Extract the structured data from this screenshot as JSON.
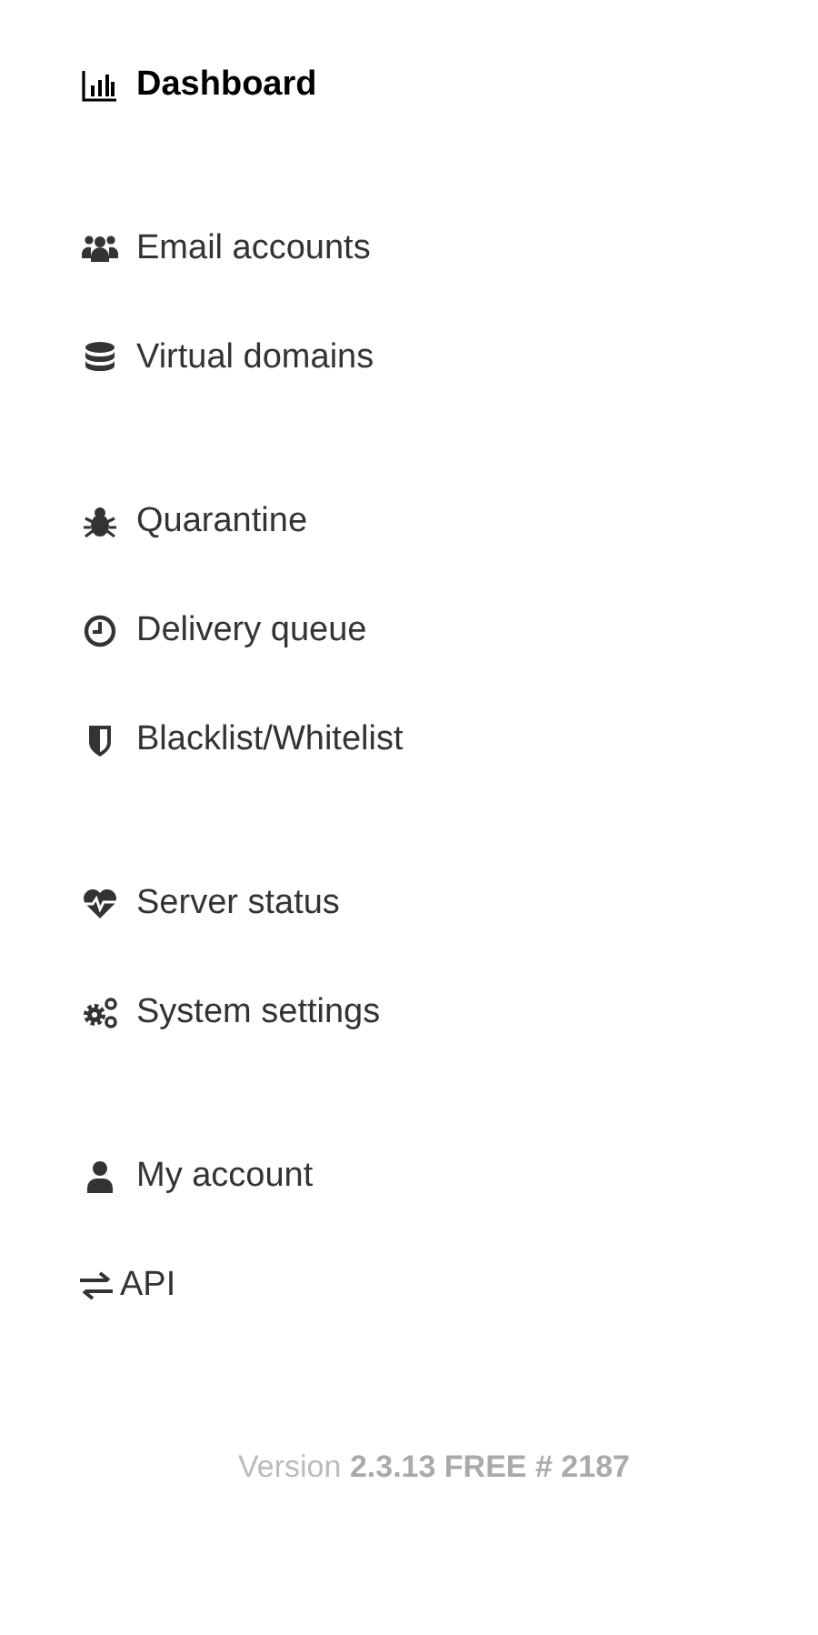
{
  "nav_groups": [
    {
      "items": [
        {
          "label": "Dashboard",
          "selected": true
        }
      ]
    },
    {
      "items": [
        {
          "label": "Email accounts",
          "selected": false
        },
        {
          "label": "Virtual domains",
          "selected": false
        }
      ]
    },
    {
      "items": [
        {
          "label": "Quarantine",
          "selected": false
        },
        {
          "label": "Delivery queue",
          "selected": false
        },
        {
          "label": "Blacklist/Whitelist",
          "selected": false
        }
      ]
    },
    {
      "items": [
        {
          "label": "Server status",
          "selected": false
        },
        {
          "label": "System settings",
          "selected": false
        }
      ]
    },
    {
      "items": [
        {
          "label": "My account",
          "selected": false
        },
        {
          "label": "API",
          "selected": false
        }
      ]
    }
  ],
  "version": "Version **2.3.13 FREE # 2187**"
}
